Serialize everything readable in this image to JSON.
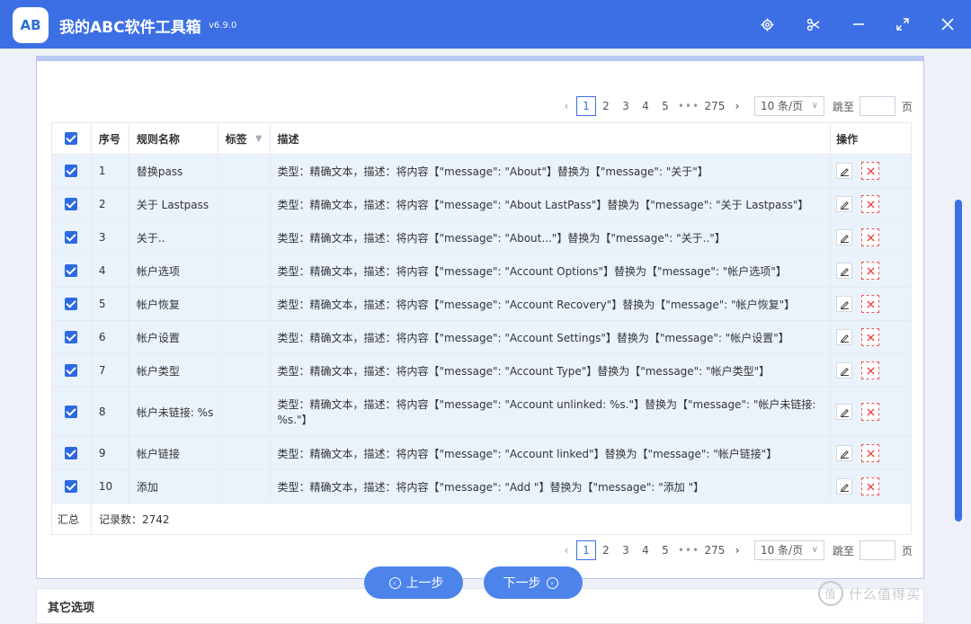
{
  "app": {
    "logo_text": "AB",
    "title": "我的ABC软件工具箱",
    "version": "v6.9.0"
  },
  "pagination": {
    "pages": [
      "1",
      "2",
      "3",
      "4",
      "5"
    ],
    "active_page": "1",
    "ellipsis": "•••",
    "last_page": "275",
    "page_size": "10 条/页",
    "jump_label": "跳至",
    "page_unit": "页"
  },
  "table": {
    "headers": {
      "no": "序号",
      "name": "规则名称",
      "tag": "标签",
      "desc": "描述",
      "ops": "操作"
    },
    "rows": [
      {
        "no": "1",
        "name": "替换pass",
        "tag": "",
        "desc": "类型：精确文本，描述：将内容【\"message\": \"About\"】替换为【\"message\": \"关于\"】"
      },
      {
        "no": "2",
        "name": "关于 Lastpass",
        "tag": "",
        "desc": "类型：精确文本，描述：将内容【\"message\": \"About LastPass\"】替换为【\"message\": \"关于 Lastpass\"】"
      },
      {
        "no": "3",
        "name": "关于..",
        "tag": "",
        "desc": "类型：精确文本，描述：将内容【\"message\": \"About...\"】替换为【\"message\": \"关于..\"】"
      },
      {
        "no": "4",
        "name": "帐户选项",
        "tag": "",
        "desc": "类型：精确文本，描述：将内容【\"message\": \"Account Options\"】替换为【\"message\": \"帐户选项\"】"
      },
      {
        "no": "5",
        "name": "帐户恢复",
        "tag": "",
        "desc": "类型：精确文本，描述：将内容【\"message\": \"Account Recovery\"】替换为【\"message\": \"帐户恢复\"】"
      },
      {
        "no": "6",
        "name": "帐户设置",
        "tag": "",
        "desc": "类型：精确文本，描述：将内容【\"message\": \"Account Settings\"】替换为【\"message\": \"帐户设置\"】"
      },
      {
        "no": "7",
        "name": "帐户类型",
        "tag": "",
        "desc": "类型：精确文本，描述：将内容【\"message\": \"Account Type\"】替换为【\"message\": \"帐户类型\"】"
      },
      {
        "no": "8",
        "name": "帐户未链接: %s",
        "tag": "",
        "desc": "类型：精确文本，描述：将内容【\"message\": \"Account unlinked: %s.\"】替换为【\"message\": \"帐户未链接: %s.\"】"
      },
      {
        "no": "9",
        "name": "帐户链接",
        "tag": "",
        "desc": "类型：精确文本，描述：将内容【\"message\": \"Account linked\"】替换为【\"message\": \"帐户链接\"】"
      },
      {
        "no": "10",
        "name": "添加",
        "tag": "",
        "desc": "类型：精确文本，描述：将内容【\"message\": \"Add \"】替换为【\"message\": \"添加 \"】"
      }
    ],
    "footer": {
      "label": "汇总",
      "record_count": "记录数：2742"
    }
  },
  "steps": {
    "prev": "上一步",
    "next": "下一步"
  },
  "other_section": {
    "title": "其它选项"
  },
  "watermark": {
    "logo": "值",
    "text": "什么值得买"
  },
  "icons": {
    "settings": "gear-icon",
    "scissors": "scissors-icon",
    "minimize": "minimize-icon",
    "maximize": "maximize-icon",
    "close": "close-icon",
    "edit": "edit-icon",
    "delete": "delete-icon",
    "filter": "filter-icon"
  },
  "colors": {
    "brand": "#3b6fe3",
    "row_bg": "#eaf3fc",
    "checkbox": "#2d6ae0",
    "delete": "#e33333"
  }
}
